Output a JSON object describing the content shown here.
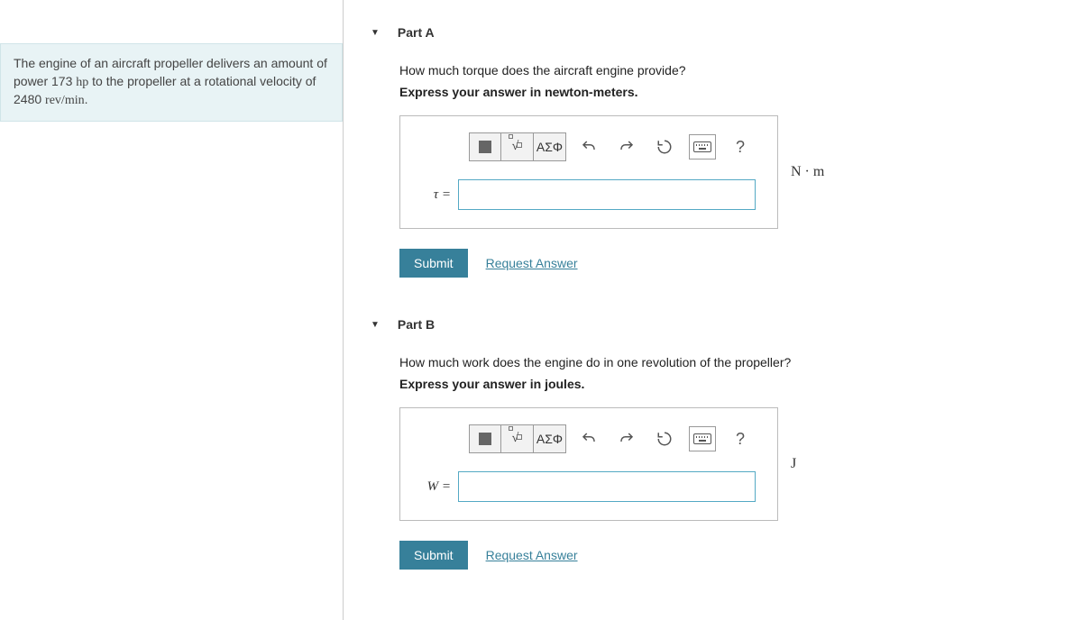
{
  "problem": {
    "prefix": "The engine of an aircraft propeller delivers an amount of power 173 ",
    "power_unit": "hp",
    "mid": " to the propeller at a rotational velocity of 2480 ",
    "vel_unit": "rev/min",
    "suffix": "."
  },
  "partA": {
    "title": "Part A",
    "question": "How much torque does the aircraft engine provide?",
    "instruction": "Express your answer in newton-meters.",
    "variable": "τ =",
    "unit": "N · m",
    "submit": "Submit",
    "request": "Request Answer"
  },
  "partB": {
    "title": "Part B",
    "question": "How much work does the engine do in one revolution of the propeller?",
    "instruction": "Express your answer in joules.",
    "variable": "W =",
    "unit": "J",
    "submit": "Submit",
    "request": "Request Answer"
  },
  "toolbar": {
    "greek": "ΑΣΦ",
    "help": "?"
  }
}
